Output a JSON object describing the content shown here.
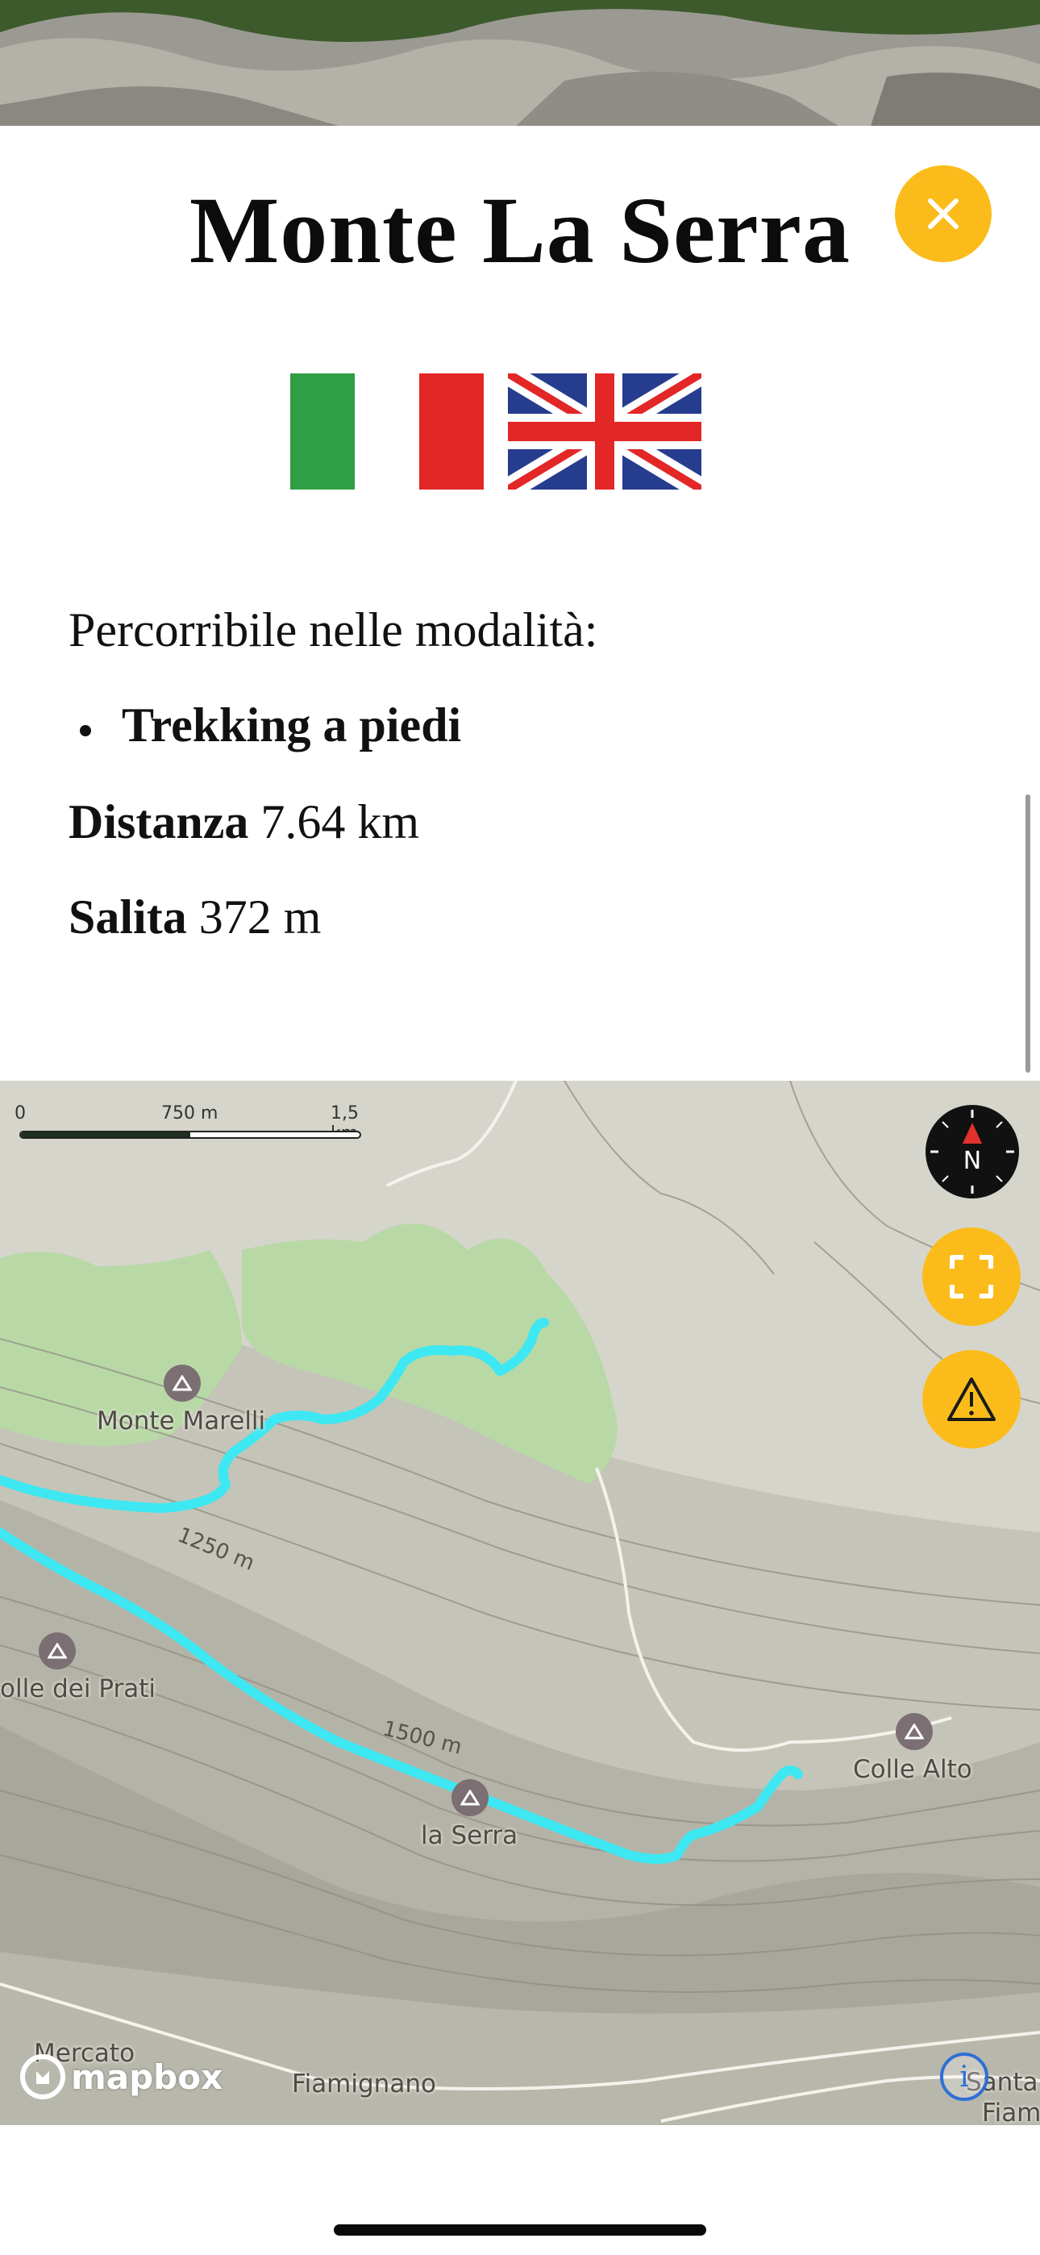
{
  "header": {
    "title": "Monte La Serra",
    "close_icon": "close-icon"
  },
  "languages": [
    {
      "name": "italian-flag",
      "colors": [
        "#2f9e44",
        "#ffffff",
        "#e32626"
      ]
    },
    {
      "name": "uk-flag",
      "colors": [
        "#253c8f",
        "#ffffff",
        "#e32626"
      ]
    }
  ],
  "info": {
    "modes_label": "Percorribile nelle modalità:",
    "modes": [
      "Trekking a piedi"
    ],
    "distance_label": "Distanza",
    "distance_value": " 7.64 km",
    "ascent_label": "Salita",
    "ascent_value": " 372 m"
  },
  "map": {
    "scale_labels": [
      "0",
      "750 m",
      "1,5 km"
    ],
    "places": {
      "monte_marelli": "Monte Marelli",
      "colle_dei_prati": "olle dei Prati",
      "la_serra": "la Serra",
      "colle_alto": "Colle Alto",
      "mercato": "Mercato",
      "fiamignano": "Fiamignano",
      "santa": "Santa",
      "fiam": "Fiam"
    },
    "contours": [
      "1250 m",
      "1500 m"
    ],
    "compass_letter": "N",
    "buttons": [
      "fullscreen-icon",
      "warning-icon"
    ],
    "logo_text": "mapbox",
    "info_glyph": "i",
    "route_color": "#3ee8f2",
    "accent": "#fbbc1b"
  }
}
